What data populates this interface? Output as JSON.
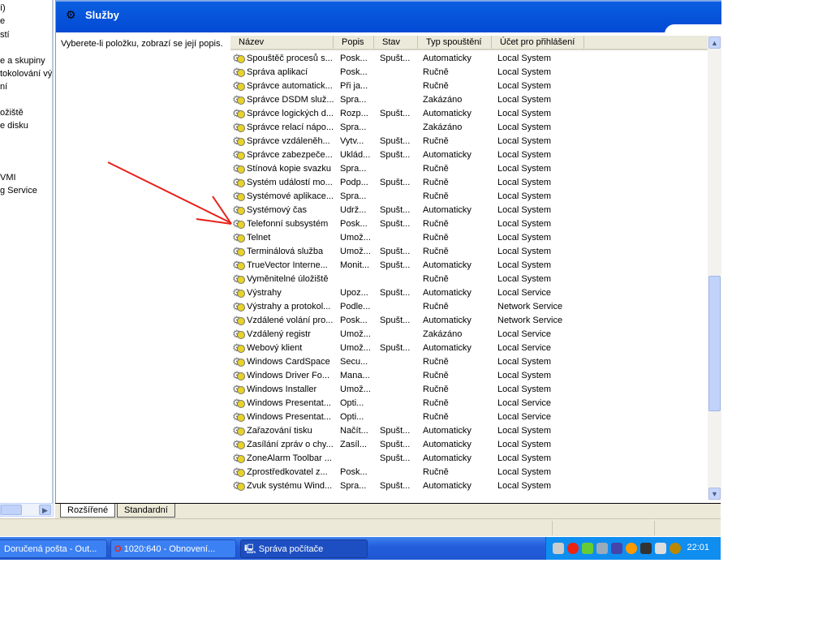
{
  "tree_fragments": [
    "í)",
    "e",
    "stí",
    "e a skupiny",
    "tokolování vý",
    "ní",
    "ožiště",
    "e disku",
    "VMI",
    "g Service"
  ],
  "header": {
    "title": "Služby"
  },
  "description": "Vyberete-li položku, zobrazí se její popis.",
  "columns": [
    "Název",
    "Popis",
    "Stav",
    "Typ spouštění",
    "Účet pro přihlášení"
  ],
  "rows": [
    [
      "Spouštěč procesů s...",
      "Posk...",
      "Spušt...",
      "Automaticky",
      "Local System"
    ],
    [
      "Správa aplikací",
      "Posk...",
      "",
      "Ručně",
      "Local System"
    ],
    [
      "Správce automatick...",
      "Při ja...",
      "",
      "Ručně",
      "Local System"
    ],
    [
      "Správce DSDM služ...",
      "Spra...",
      "",
      "Zakázáno",
      "Local System"
    ],
    [
      "Správce logických d...",
      "Rozp...",
      "Spušt...",
      "Automaticky",
      "Local System"
    ],
    [
      "Správce relací nápo...",
      "Spra...",
      "",
      "Zakázáno",
      "Local System"
    ],
    [
      "Správce vzdáleněh...",
      "Vytv...",
      "Spušt...",
      "Ručně",
      "Local System"
    ],
    [
      "Správce zabezpeče...",
      "Uklád...",
      "Spušt...",
      "Automaticky",
      "Local System"
    ],
    [
      "Stínová kopie svazku",
      "Spra...",
      "",
      "Ručně",
      "Local System"
    ],
    [
      "Systém událostí mo...",
      "Podp...",
      "Spušt...",
      "Ručně",
      "Local System"
    ],
    [
      "Systémové aplikace...",
      "Spra...",
      "",
      "Ručně",
      "Local System"
    ],
    [
      "Systémový čas",
      "Udrž...",
      "Spušt...",
      "Automaticky",
      "Local System"
    ],
    [
      "Telefonní subsystém",
      "Posk...",
      "Spušt...",
      "Ručně",
      "Local System"
    ],
    [
      "Telnet",
      "Umož...",
      "",
      "Ručně",
      "Local System"
    ],
    [
      "Terminálová služba",
      "Umož...",
      "Spušt...",
      "Ručně",
      "Local System"
    ],
    [
      "TrueVector Interne...",
      "Monit...",
      "Spušt...",
      "Automaticky",
      "Local System"
    ],
    [
      "Vyměnitelné úložiště",
      "",
      "",
      "Ručně",
      "Local System"
    ],
    [
      "Výstrahy",
      "Upoz...",
      "Spušt...",
      "Automaticky",
      "Local Service"
    ],
    [
      "Výstrahy a protokol...",
      "Podle...",
      "",
      "Ručně",
      "Network Service"
    ],
    [
      "Vzdálené volání pro...",
      "Posk...",
      "Spušt...",
      "Automaticky",
      "Network Service"
    ],
    [
      "Vzdálený registr",
      "Umož...",
      "",
      "Zakázáno",
      "Local Service"
    ],
    [
      "Webový klient",
      "Umož...",
      "Spušt...",
      "Automaticky",
      "Local Service"
    ],
    [
      "Windows CardSpace",
      "Secu...",
      "",
      "Ručně",
      "Local System"
    ],
    [
      "Windows Driver Fo...",
      "Mana...",
      "",
      "Ručně",
      "Local System"
    ],
    [
      "Windows Installer",
      "Umož...",
      "",
      "Ručně",
      "Local System"
    ],
    [
      "Windows Presentat...",
      "Opti...",
      "",
      "Ručně",
      "Local Service"
    ],
    [
      "Windows Presentat...",
      "Opti...",
      "",
      "Ručně",
      "Local Service"
    ],
    [
      "Zařazování tisku",
      "Načít...",
      "Spušt...",
      "Automaticky",
      "Local System"
    ],
    [
      "Zasílání zpráv o chy...",
      "Zasíl...",
      "Spušt...",
      "Automaticky",
      "Local System"
    ],
    [
      "ZoneAlarm Toolbar ...",
      "",
      "Spušt...",
      "Automaticky",
      "Local System"
    ],
    [
      "Zprostředkovatel z...",
      "Posk...",
      "",
      "Ručně",
      "Local System"
    ],
    [
      "Zvuk systému Wind...",
      "Spra...",
      "Spušt...",
      "Automaticky",
      "Local System"
    ]
  ],
  "scroll_position_fraction": 0.75,
  "tabs": [
    "Rozšířené",
    "Standardní"
  ],
  "taskbar": {
    "buttons": [
      "Doručená pošta - Out...",
      "1020:640 - Obnovení...",
      "Správa počítače"
    ],
    "clock": "22:01"
  },
  "annotation_color": "#e8201a"
}
